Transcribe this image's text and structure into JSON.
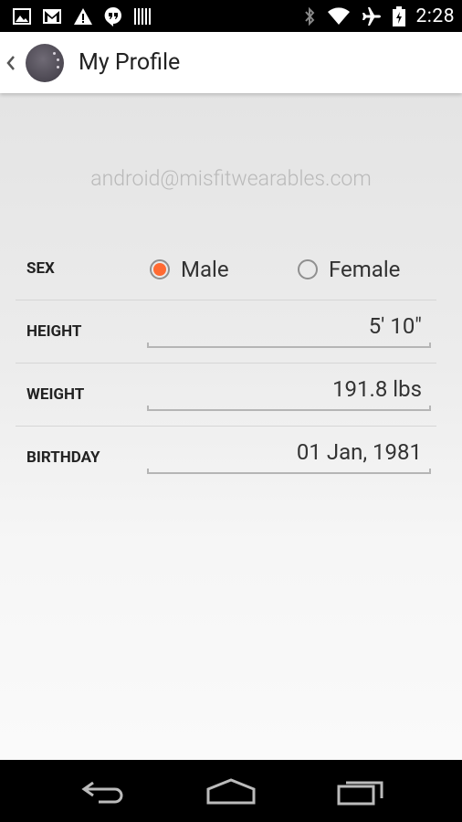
{
  "status_bar": {
    "time": "2:28",
    "icons_left": [
      "image-icon",
      "gmail-icon",
      "warning-icon",
      "hangouts-icon",
      "barcode-icon"
    ],
    "icons_right": [
      "bluetooth-icon",
      "wifi-icon",
      "airplane-icon",
      "battery-charging-icon"
    ]
  },
  "header": {
    "title": "My Profile",
    "icons": [
      "back-chevron-icon",
      "avatar"
    ]
  },
  "profile": {
    "email": "android@misfitwearables.com"
  },
  "form": {
    "sex": {
      "label": "SEX",
      "options": [
        "Male",
        "Female"
      ],
      "selected": "Male",
      "accent_color": "#ff6a32"
    },
    "height": {
      "label": "HEIGHT",
      "value": "5' 10\""
    },
    "weight": {
      "label": "WEIGHT",
      "value": "191.8 lbs"
    },
    "birthday": {
      "label": "BIRTHDAY",
      "value": "01 Jan, 1981"
    }
  },
  "nav_bar": {
    "icons": [
      "back-icon",
      "home-icon",
      "recents-icon"
    ]
  }
}
